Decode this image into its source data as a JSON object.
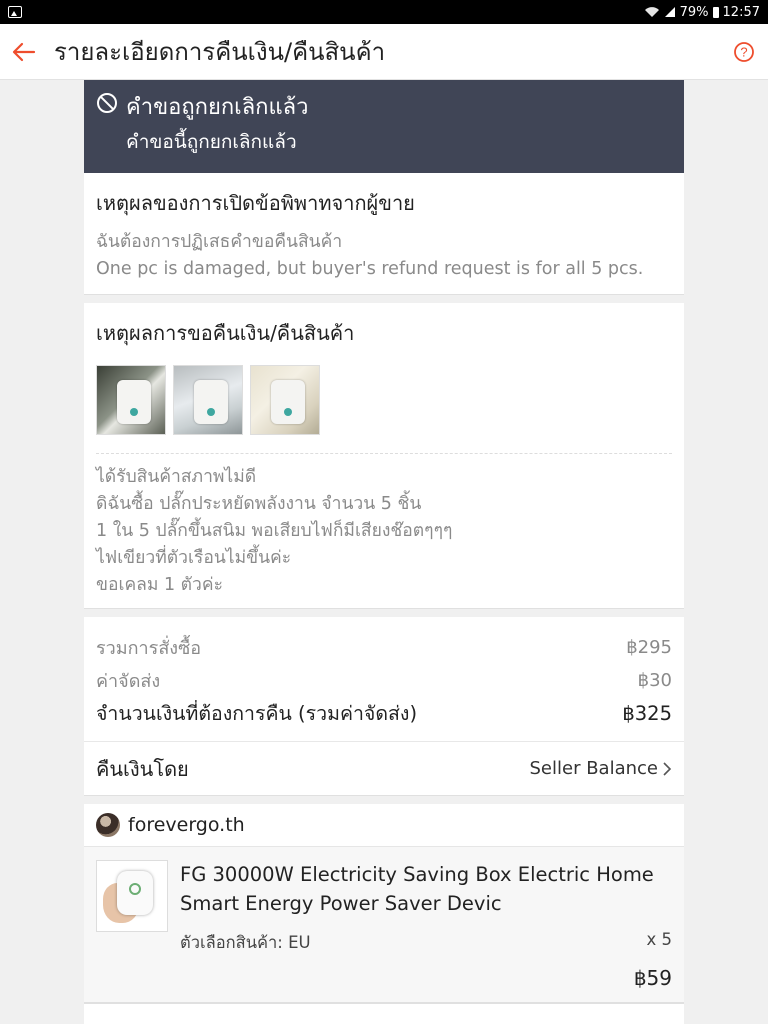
{
  "statusbar": {
    "battery": "79%",
    "time": "12:57"
  },
  "header": {
    "title": "รายละเอียดการคืนเงิน/คืนสินค้า"
  },
  "banner": {
    "title": "คำขอถูกยกเลิกแล้ว",
    "subtitle": "คำขอนี้ถูกยกเลิกแล้ว"
  },
  "dispute": {
    "heading": "เหตุผลของการเปิดข้อพิพาทจากผู้ขาย",
    "reason": "ฉันต้องการปฏิเสธคำขอคืนสินค้า",
    "note": "One pc is damaged, but buyer's refund request is for all 5 pcs."
  },
  "request_reason": {
    "heading": "เหตุผลการขอคืนเงิน/คืนสินค้า",
    "lines": [
      "ได้รับสินค้าสภาพไม่ดี",
      "ดิฉันซื้อ ปลั๊กประหยัดพลังงาน จำนวน 5 ชิ้น",
      "1 ใน 5 ปลั๊กขึ้นสนิม พอเสียบไฟก็มีเสียงช๊อตๆๆๆ",
      "ไฟเขียวที่ตัวเรือนไม่ขึ้นค่ะ",
      "ขอเคลม 1 ตัวค่ะ"
    ]
  },
  "summary": {
    "order_total_label": "รวมการสั่งซื้อ",
    "order_total": "฿295",
    "shipping_label": "ค่าจัดส่ง",
    "shipping": "฿30",
    "refund_total_label": "จำนวนเงินที่ต้องการคืน (รวมค่าจัดส่ง)",
    "refund_total": "฿325"
  },
  "refund_method": {
    "label": "คืนเงินโดย",
    "value": "Seller Balance"
  },
  "shop": {
    "name": "forevergo.th"
  },
  "product": {
    "name": "FG 30000W Electricity Saving Box Electric Home Smart Energy Power Saver Devic",
    "variation": "ตัวเลือกสินค้า: EU",
    "quantity": "x 5",
    "price": "฿59"
  },
  "colors": {
    "accent": "#ee4d2d",
    "banner": "#404556"
  }
}
